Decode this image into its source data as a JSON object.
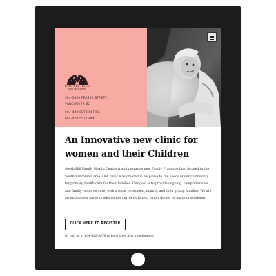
{
  "hero": {
    "logo_name": "SOUTH HILL",
    "logo_subtitle": "FAMILY HEALTH CENTRE",
    "address_line1": "504-5669 FRASER STREET,",
    "address_line2": "VANCOUVER BC",
    "office_phone": "604-428-8878 OFFICE",
    "fax": "604-428-5571 FAX",
    "menu_icon": "hamburger-menu-icon",
    "brand_color": "#f8aba3"
  },
  "main": {
    "headline": "An Innovative new clinic for women and their Children",
    "description": "South Hill Family Health Centre is an innovative new Family Practice clinic located in the South Vancouver area. Our clinic was created in response to the needs of our community - for primary health care for their families. Our goal is to provide ongoing, comprehensive and family-centered care, with a focus on women, infants, and their young families. We are accepting new patients who do not currently have a family doctor or nurse practitioner.",
    "register_label": "CLICK HERE TO REGISTER",
    "call_text": "Or call us at 604-428-8878 to book your first appointment"
  }
}
